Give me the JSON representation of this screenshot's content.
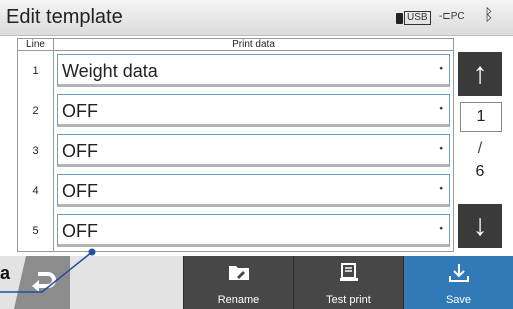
{
  "header": {
    "title": "Edit template",
    "usb_label": "USB",
    "pc_label": "PC",
    "bluetooth_icon": "bluetooth-icon"
  },
  "table": {
    "col_line": "Line",
    "col_data": "Print data",
    "rows": [
      {
        "line": "1",
        "value": "Weight data"
      },
      {
        "line": "2",
        "value": "OFF"
      },
      {
        "line": "3",
        "value": "OFF"
      },
      {
        "line": "4",
        "value": "OFF"
      },
      {
        "line": "5",
        "value": "OFF"
      }
    ]
  },
  "pager": {
    "current": "1",
    "slash": "/",
    "total": "6"
  },
  "footer": {
    "rename": "Rename",
    "test_print": "Test print",
    "save": "Save"
  },
  "callout": {
    "edge_text": "a"
  },
  "colors": {
    "header_bg": "#dcdcdc",
    "dark_button": "#474747",
    "save_button": "#3279b8",
    "cell_border": "#6a9fc9"
  }
}
